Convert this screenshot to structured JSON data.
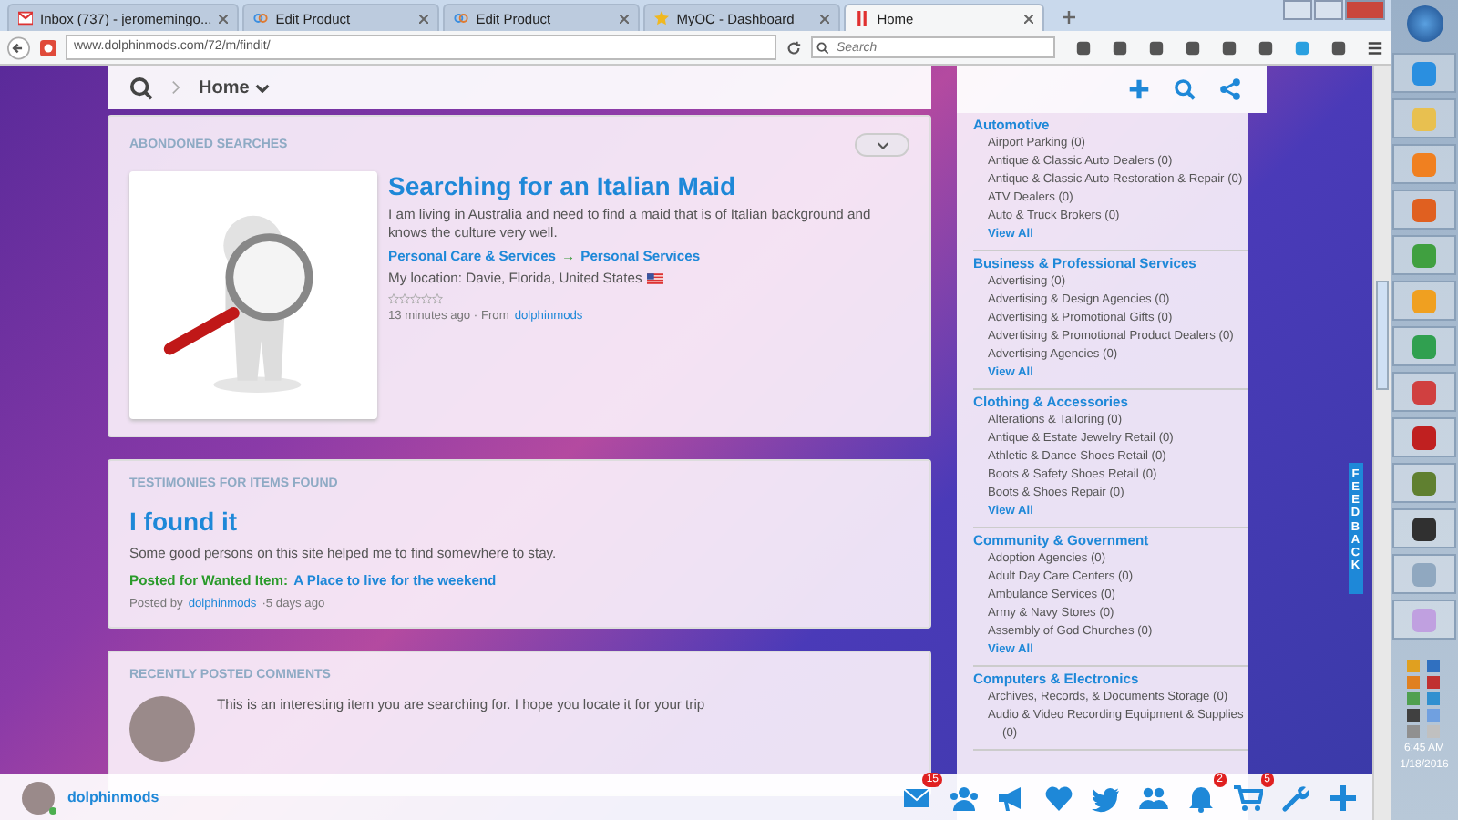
{
  "browser": {
    "tabs": [
      {
        "kind": "mail",
        "label": "Inbox (737) - jeromemingo...",
        "selected": false
      },
      {
        "kind": "link",
        "label": "Edit Product",
        "selected": false
      },
      {
        "kind": "link",
        "label": "Edit Product",
        "selected": false
      },
      {
        "kind": "star",
        "label": "MyOC - Dashboard",
        "selected": false
      },
      {
        "kind": "bars",
        "label": "Home",
        "selected": true
      }
    ],
    "address": "www.dolphinmods.com/72/m/findit/",
    "search": {
      "placeholder": "Search"
    }
  },
  "header": {
    "breadcrumb": "Home"
  },
  "abandoned": {
    "title": "ABONDONED SEARCHES",
    "item": {
      "title": "Searching for an Italian Maid",
      "description": "I am living in Australia and need to find a maid that is of Italian background and knows the culture very well.",
      "category": "Personal Care & Services",
      "arrow": "→",
      "subcategory": "Personal Services",
      "location": "My location: Davie, Florida, United States",
      "stars": 0,
      "time": "13 minutes ago · From",
      "user": "dolphinmods"
    }
  },
  "testimonies": {
    "title": "TESTIMONIES FOR ITEMS FOUND",
    "heading": "I found it",
    "body": "Some good persons on this site helped me to find somewhere to stay.",
    "posted_label": "Posted for Wanted Item:",
    "posted_link": "A Place to live for the weekend",
    "by_label": "Posted by",
    "user": "dolphinmods",
    "time": "·5 days ago"
  },
  "comments": {
    "title": "RECENTLY POSTED COMMENTS",
    "items": [
      {
        "text": "This is an interesting item you are searching for. I hope you locate it for your trip"
      }
    ]
  },
  "sidebar": {
    "groups": [
      {
        "title": "Automotive",
        "items": [
          "Airport Parking (0)",
          "Antique & Classic Auto Dealers (0)",
          "Antique & Classic Auto Restoration & Repair (0)",
          "ATV Dealers (0)",
          "Auto & Truck Brokers (0)"
        ],
        "more": "View All"
      },
      {
        "title": "Business & Professional Services",
        "items": [
          "Advertising (0)",
          "Advertising & Design Agencies (0)",
          "Advertising & Promotional Gifts (0)",
          "Advertising & Promotional Product Dealers (0)",
          "Advertising Agencies (0)"
        ],
        "more": "View All"
      },
      {
        "title": "Clothing & Accessories",
        "items": [
          "Alterations & Tailoring (0)",
          "Antique & Estate Jewelry Retail (0)",
          "Athletic & Dance Shoes Retail (0)",
          "Boots & Safety Shoes Retail (0)",
          "Boots & Shoes Repair (0)"
        ],
        "more": "View All"
      },
      {
        "title": "Community & Government",
        "items": [
          "Adoption Agencies (0)",
          "Adult Day Care Centers (0)",
          "Ambulance Services (0)",
          "Army & Navy Stores (0)",
          "Assembly of God Churches (0)"
        ],
        "more": "View All"
      },
      {
        "title": "Computers & Electronics",
        "items": [
          "Archives, Records, & Documents Storage (0)",
          "Audio & Video Recording Equipment & Supplies (0)"
        ]
      }
    ]
  },
  "feedback": "FEEDBACK",
  "bottom_bar": {
    "user": "dolphinmods",
    "online": true,
    "icons": [
      {
        "kind": "mail",
        "badge": "15"
      },
      {
        "kind": "users"
      },
      {
        "kind": "megaphone"
      },
      {
        "kind": "heart"
      },
      {
        "kind": "bird"
      },
      {
        "kind": "group"
      },
      {
        "kind": "bell",
        "badge": "2"
      },
      {
        "kind": "cart",
        "badge": "5"
      },
      {
        "kind": "wrench"
      },
      {
        "kind": "plus"
      }
    ]
  },
  "taskbar": {
    "time": "6:45 AM",
    "date": "1/18/2016"
  }
}
